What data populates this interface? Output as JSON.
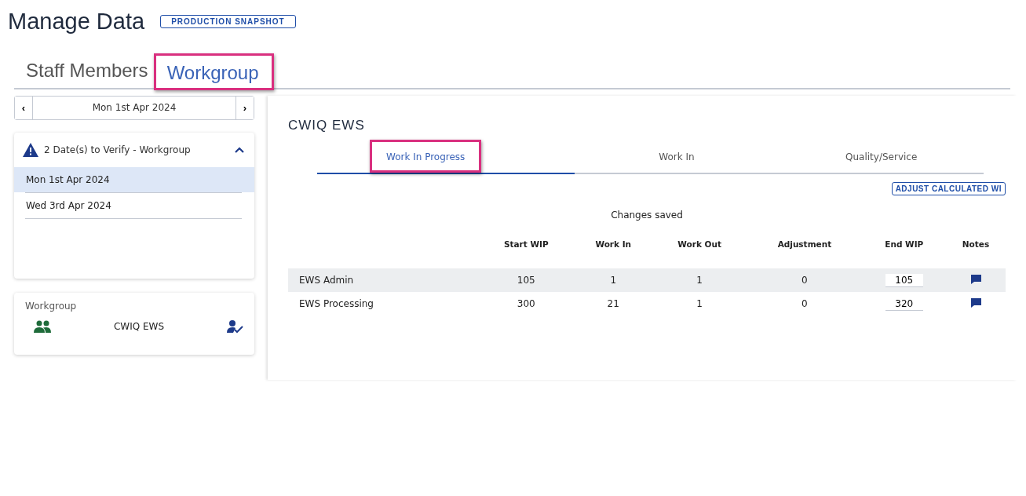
{
  "page": {
    "title": "Manage Data",
    "badge": "PRODUCTION SNAPSHOT"
  },
  "tabs": [
    {
      "label": "Staff Members",
      "selected": false,
      "highlighted": false
    },
    {
      "label": "Workgroup",
      "selected": true,
      "highlighted": true
    }
  ],
  "date_picker": {
    "prev": "‹",
    "value": "Mon 1st Apr 2024",
    "next": "›"
  },
  "verify_panel": {
    "title": "2 Date(s) to Verify - Workgroup",
    "expanded": true,
    "dates": [
      {
        "label": "Mon 1st Apr 2024",
        "selected": true
      },
      {
        "label": "Wed 3rd Apr 2024",
        "selected": false
      }
    ]
  },
  "workgroup_card": {
    "heading": "Workgroup",
    "name": "CWIQ EWS"
  },
  "main": {
    "title": "CWIQ EWS",
    "tabs": [
      {
        "label": "Work In Progress",
        "selected": true,
        "highlighted": true
      },
      {
        "label": "Work In",
        "selected": false,
        "highlighted": false
      },
      {
        "label": "Quality/Service",
        "selected": false,
        "highlighted": false
      }
    ],
    "adjust_button": "ADJUST CALCULATED WI",
    "status": "Changes saved",
    "table": {
      "columns": [
        "Start WIP",
        "Work In",
        "Work Out",
        "Adjustment",
        "End WIP",
        "Notes"
      ],
      "rows": [
        {
          "name": "EWS Admin",
          "start_wip": "105",
          "work_in": "1",
          "work_out": "1",
          "adjustment": "0",
          "end_wip": "105",
          "shaded": true
        },
        {
          "name": "EWS Processing",
          "start_wip": "300",
          "work_in": "21",
          "work_out": "1",
          "adjustment": "0",
          "end_wip": "320",
          "shaded": false
        }
      ]
    }
  }
}
